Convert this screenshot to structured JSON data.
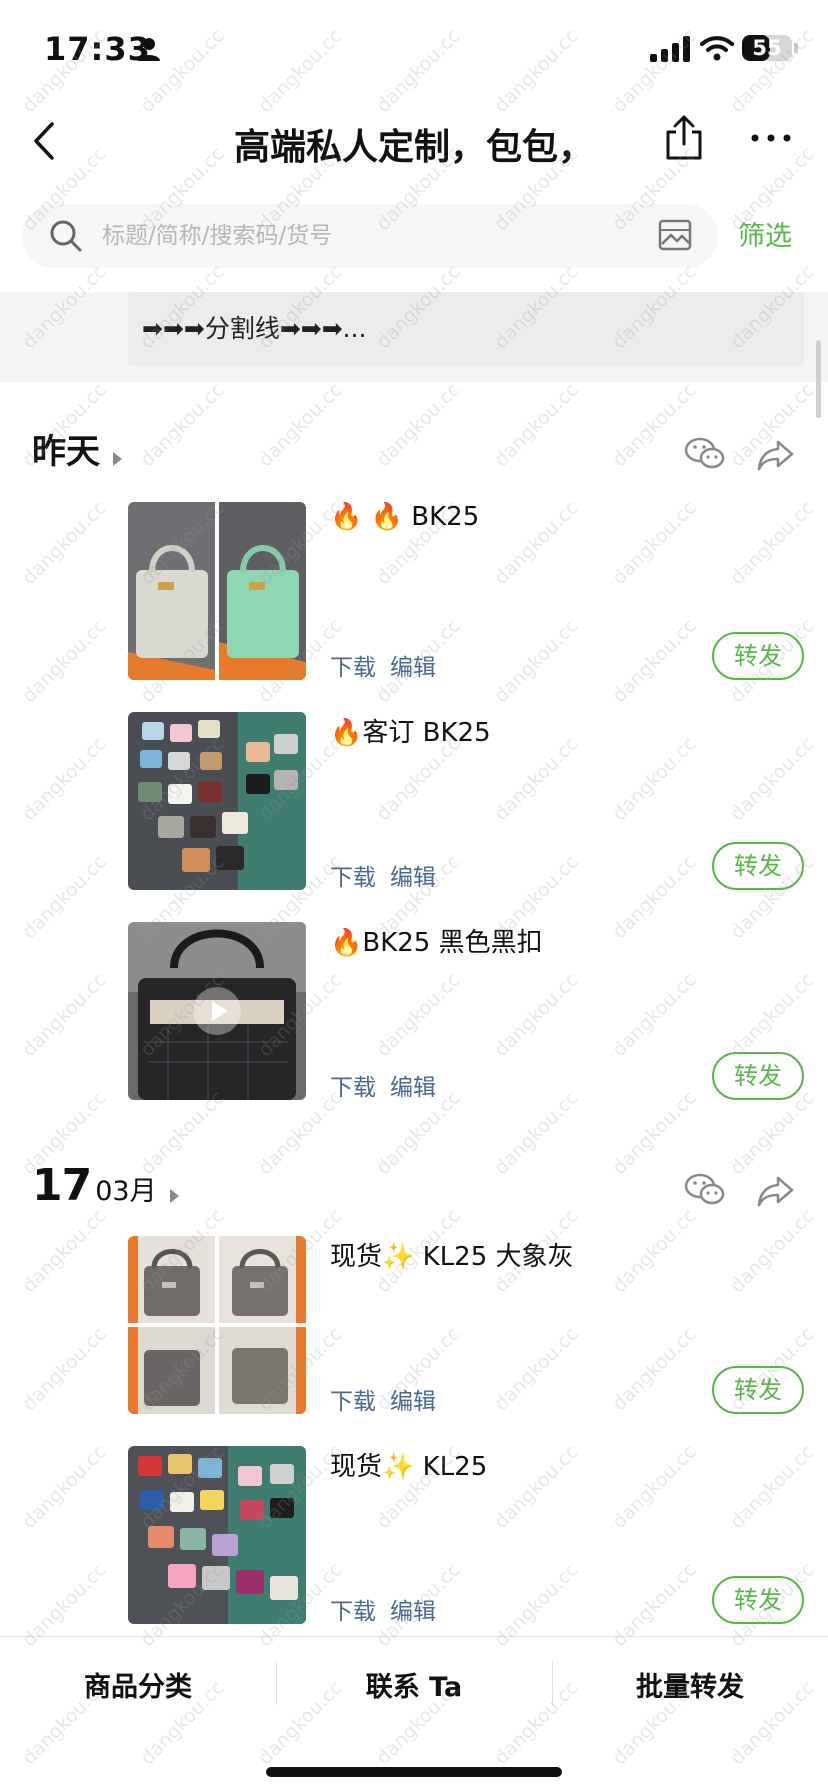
{
  "status_bar": {
    "time": "17:33",
    "battery_level": "55",
    "battery_fraction": 0.55
  },
  "nav": {
    "title": "高端私人定制，包包，"
  },
  "search": {
    "placeholder": "标题/简称/搜索码/货号",
    "value": "",
    "filter_label": "筛选"
  },
  "divider_post": {
    "text": "➡➡➡分割线➡➡➡..."
  },
  "sections": [
    {
      "day_label": "昨天",
      "posts": [
        {
          "title": "🔥 🔥 BK25",
          "download": "下载",
          "edit": "编辑",
          "repost": "转发"
        },
        {
          "title": "🔥客订 BK25",
          "download": "下载",
          "edit": "编辑",
          "repost": "转发"
        },
        {
          "title": "🔥BK25 黑色黑扣",
          "download": "下载",
          "edit": "编辑",
          "repost": "转发"
        }
      ]
    },
    {
      "day_num": "17",
      "month": "03月",
      "posts": [
        {
          "title": "现货✨ KL25 大象灰",
          "download": "下载",
          "edit": "编辑",
          "repost": "转发"
        },
        {
          "title": "现货✨ KL25",
          "download": "下载",
          "edit": "编辑",
          "repost": "转发"
        }
      ]
    }
  ],
  "bottom_bar": {
    "category": "商品分类",
    "contact": "联系 Ta",
    "batch_repost": "批量转发"
  },
  "watermark": "dangkou.cc",
  "colors": {
    "accent_green": "#57b848",
    "link_blue": "#4a6894"
  }
}
